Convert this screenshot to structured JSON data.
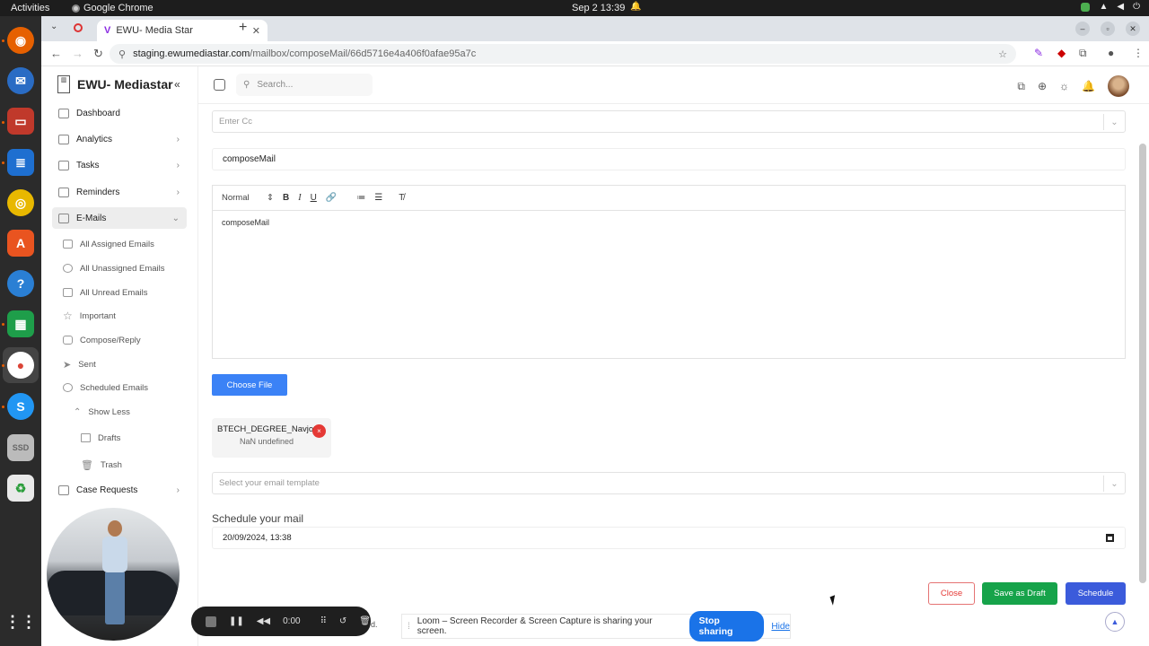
{
  "system": {
    "activities": "Activities",
    "app_name": "Google Chrome",
    "clock": "Sep 2  13:39"
  },
  "browser": {
    "tab_title": "EWU- Media Star",
    "url_host": "staging.ewumediastar.com",
    "url_path": "/mailbox/composeMail/66d5716e4a406f0afae95a7c"
  },
  "sidebar": {
    "brand": "EWU- Mediastar",
    "items": [
      {
        "label": "Dashboard"
      },
      {
        "label": "Analytics"
      },
      {
        "label": "Tasks"
      },
      {
        "label": "Reminders"
      },
      {
        "label": "E-Mails"
      },
      {
        "label": "Case Requests"
      }
    ],
    "email_subitems": [
      {
        "label": "All Assigned Emails"
      },
      {
        "label": "All Unassigned Emails"
      },
      {
        "label": "All Unread Emails"
      },
      {
        "label": "Important"
      },
      {
        "label": "Compose/Reply"
      },
      {
        "label": "Sent"
      },
      {
        "label": "Scheduled Emails"
      },
      {
        "label": "Show Less"
      },
      {
        "label": "Drafts"
      },
      {
        "label": "Trash"
      }
    ]
  },
  "header": {
    "search_placeholder": "Search..."
  },
  "compose": {
    "cc_placeholder": "Enter Cc",
    "subject": "composeMail",
    "format": "Normal",
    "body": "composeMail",
    "choose_file": "Choose File",
    "attachment": {
      "name": "BTECH_DEGREE_Navjot",
      "size": "NaN undefined"
    },
    "template_placeholder": "Select your email template",
    "schedule_label": "Schedule your mail",
    "schedule_value": "20/09/2024, 13:38",
    "btn_close": "Close",
    "btn_draft": "Save as Draft",
    "btn_schedule": "Schedule"
  },
  "loom": {
    "timer": "0:00",
    "share_msg": "Loom – Screen Recorder & Screen Capture is sharing your screen.",
    "stop": "Stop sharing",
    "hide": "Hide",
    "behind_text": "d."
  }
}
